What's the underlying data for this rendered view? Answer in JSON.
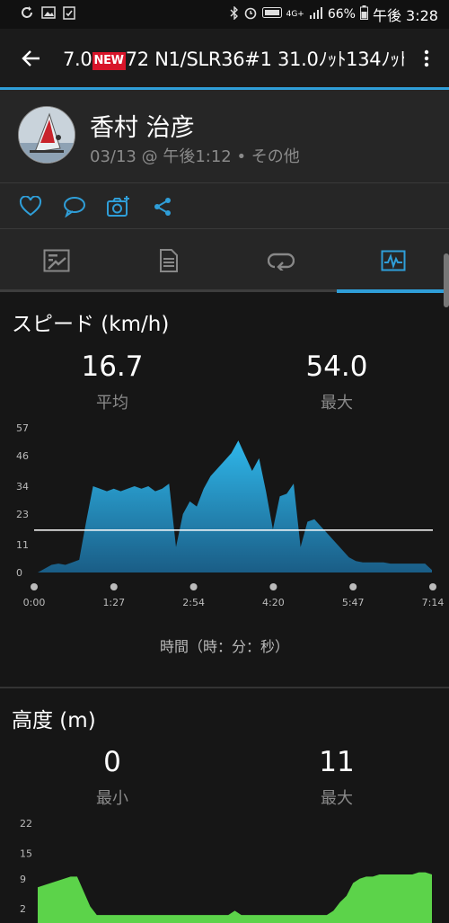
{
  "status": {
    "battery": "66%",
    "time": "午後 3:28",
    "network": "4G+"
  },
  "appbar": {
    "title_pre": "7.0",
    "badge": "NEW",
    "title_post": "72 N1/SLR36#1 31.0ﾉｯﾄ134ﾉｯﾄ"
  },
  "profile": {
    "name": "香村 治彦",
    "subtitle": "03/13 @ 午後1:12 • その他"
  },
  "actions": [
    "heart-icon",
    "comment-icon",
    "camera-add-icon",
    "share-icon"
  ],
  "tabs": [
    "summary-tab",
    "details-tab",
    "laps-tab",
    "charts-tab"
  ],
  "speed": {
    "title": "スピード (km/h)",
    "avg_value": "16.7",
    "avg_label": "平均",
    "max_value": "54.0",
    "max_label": "最大",
    "axis_title": "時間（時：分：秒）"
  },
  "altitude": {
    "title": "高度 (m)",
    "min_value": "0",
    "min_label": "最小",
    "max_value": "11",
    "max_label": "最大"
  },
  "chart_data": [
    {
      "type": "area",
      "title": "スピード (km/h)",
      "xlabel": "時間（時：分：秒）",
      "ylabel": "",
      "x_ticks": [
        "0:00",
        "1:27",
        "2:54",
        "4:20",
        "5:47",
        "7:14"
      ],
      "y_ticks": [
        0,
        11,
        23,
        34,
        46,
        57
      ],
      "ylim": [
        0,
        57
      ],
      "average_line": 16.7,
      "series": [
        {
          "values": [
            0,
            1.5,
            3,
            3.5,
            3,
            4,
            5,
            20,
            34,
            33,
            32,
            33,
            32,
            33,
            34,
            33,
            34,
            32,
            33,
            35,
            10,
            23,
            28,
            26,
            33,
            38,
            41,
            44,
            47,
            52,
            46,
            40,
            45,
            32,
            17,
            30,
            31,
            35,
            10,
            20,
            21,
            18,
            15,
            12,
            9,
            6,
            4.5,
            4,
            4,
            4,
            4,
            3.5,
            3.5,
            3.5,
            3.5,
            3.5,
            3.5,
            1
          ]
        }
      ],
      "color": "#2aaee0"
    },
    {
      "type": "area",
      "title": "高度 (m)",
      "y_ticks": [
        2,
        9,
        15,
        22
      ],
      "series": [
        {
          "values": [
            7,
            7.5,
            8,
            8.5,
            9,
            9.5,
            9.5,
            6,
            2.5,
            0.5,
            0.5,
            0.5,
            0.5,
            0.5,
            0.5,
            0.5,
            0.5,
            0.5,
            0.5,
            0.5,
            0.5,
            0.5,
            0.5,
            0.5,
            0.5,
            0.5,
            0.5,
            0.5,
            0.5,
            0.5,
            1.5,
            0.5,
            0.5,
            0.5,
            0.5,
            0.5,
            0.5,
            0.5,
            0.5,
            0.5,
            0.5,
            0.5,
            0.5,
            0.5,
            0.5,
            1.5,
            3.5,
            5,
            8,
            9,
            9.5,
            9.5,
            10,
            10,
            10,
            10,
            10,
            10,
            10.5,
            10.5,
            10
          ]
        }
      ],
      "color": "#5cd34a"
    }
  ]
}
